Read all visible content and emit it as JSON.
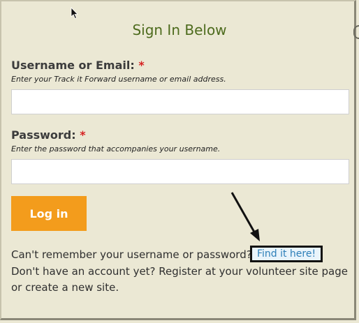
{
  "form": {
    "title": "Sign In Below",
    "username": {
      "label": "Username or Email:",
      "required_mark": "*",
      "hint": "Enter your Track it Forward username or email address.",
      "value": "",
      "placeholder": ""
    },
    "password": {
      "label": "Password:",
      "required_mark": "*",
      "hint": "Enter the password that accompanies your username.",
      "value": "",
      "placeholder": ""
    },
    "login_button": "Log in"
  },
  "help": {
    "forgot_text": "Can't remember your username or password?",
    "forgot_link": "Find it here!",
    "register_line1": "Don't have an account yet? Register at your volunteer site page",
    "register_line2": "or create a new site."
  },
  "colors": {
    "background": "#ebe8d4",
    "title": "#4d6b1d",
    "button": "#f39c1c",
    "link": "#2d7fb8",
    "required": "#d62020"
  }
}
